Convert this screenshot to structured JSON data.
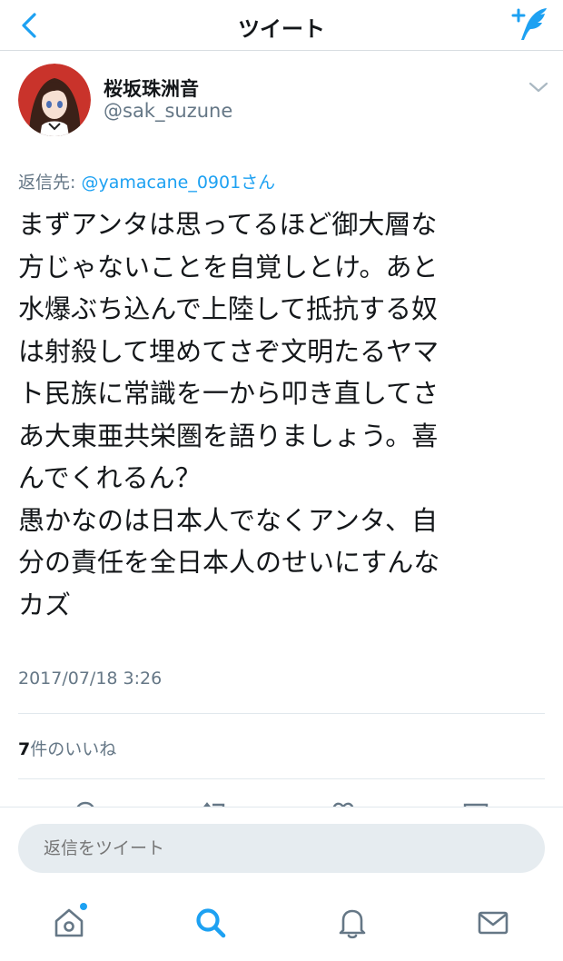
{
  "nav": {
    "title": "ツイート",
    "icons": {
      "back": "chevron-left-icon",
      "compose": "compose-tweet-icon"
    }
  },
  "tweet": {
    "author_name": "桜坂珠洲音",
    "author_handle": "@sak_suzune",
    "reply_prefix": "返信先: ",
    "reply_mention": "@yamacane_0901さん",
    "body_lines": [
      "まずアンタは思ってるほど御大層な",
      "方じゃないことを自覚しとけ。あと",
      "水爆ぶち込んで上陸して抵抗する奴",
      "は射殺して埋めてさぞ文明たるヤマ",
      "ト民族に常識を一から叩き直してさ",
      "あ大東亜共栄圏を語りましょう。喜",
      "んでくれるん？",
      "愚かなのは日本人でなくアンタ、自",
      "分の責任を全日本人のせいにすんな",
      "カズ"
    ],
    "timestamp": "2017/07/18 3:26",
    "likes_count": "7",
    "likes_suffix": "件のいいね"
  },
  "reply_bar": {
    "placeholder": "返信をツイート"
  },
  "tabbar": {
    "items": [
      {
        "name": "home",
        "icon": "home-icon",
        "active": false,
        "badge": true
      },
      {
        "name": "search",
        "icon": "search-icon",
        "active": true,
        "badge": false
      },
      {
        "name": "notifications",
        "icon": "bell-icon",
        "active": false,
        "badge": false
      },
      {
        "name": "messages",
        "icon": "envelope-icon",
        "active": false,
        "badge": false
      }
    ]
  },
  "colors": {
    "accent": "#1da1f2",
    "text": "#14171a",
    "secondary": "#657786",
    "divider": "#e1e8ed",
    "input_bg": "#e6ecf0"
  }
}
